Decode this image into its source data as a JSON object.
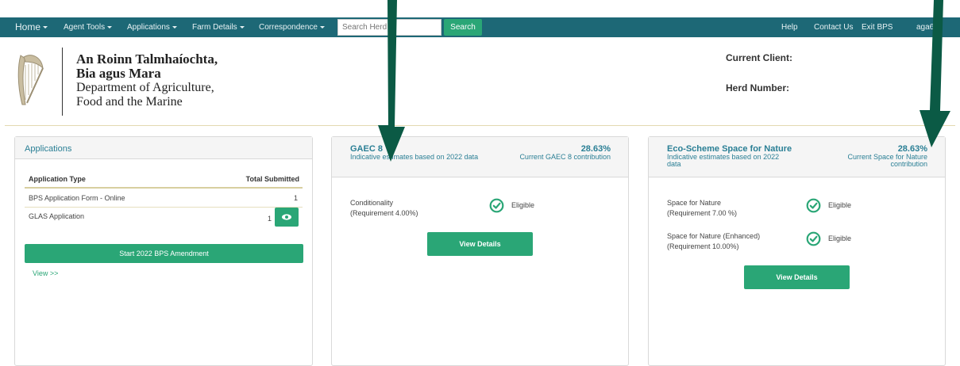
{
  "nav": {
    "home": "Home",
    "agent_tools": "Agent Tools",
    "applications": "Applications",
    "farm_details": "Farm Details",
    "correspondence": "Correspondence",
    "search_placeholder": "Search Herd",
    "search_button": "Search",
    "help": "Help",
    "contact_us": "Contact Us",
    "exit_bps": "Exit BPS",
    "user": "aga6r5"
  },
  "header": {
    "dept_line1": "An Roinn Talmhaíochta,",
    "dept_line2": "Bia agus Mara",
    "dept_line3": "Department of Agriculture,",
    "dept_line4": "Food and the Marine",
    "current_client_label": "Current Client:",
    "herd_number_label": "Herd Number:"
  },
  "applications_panel": {
    "title": "Applications",
    "col_type": "Application Type",
    "col_total": "Total Submitted",
    "rows": [
      {
        "type": "BPS Application Form - Online",
        "total": "1"
      },
      {
        "type": "GLAS Application",
        "total": "1"
      }
    ],
    "amend_button": "Start 2022 BPS Amendment",
    "view_link": "View >>"
  },
  "gaec_card": {
    "title": "GAEC 8",
    "subtitle": "Indicative estimates based on 2022 data",
    "percent": "28.63%",
    "percent_label": "Current GAEC 8 contribution",
    "criteria": [
      {
        "label": "Conditionality",
        "requirement": "(Requirement 4.00%)",
        "status": "Eligible"
      }
    ],
    "button": "View Details"
  },
  "eco_card": {
    "title": "Eco-Scheme Space for Nature",
    "subtitle": "Indicative estimates based on 2022 data",
    "percent": "28.63%",
    "percent_label": "Current Space for Nature contribution",
    "criteria": [
      {
        "label": "Space for Nature",
        "requirement": "(Requirement 7.00 %)",
        "status": "Eligible"
      },
      {
        "label": "Space for Nature (Enhanced)",
        "requirement": "(Requirement 10.00%)",
        "status": "Eligible"
      }
    ],
    "button": "View Details"
  },
  "colors": {
    "navbar": "#1d6876",
    "accent_green": "#2aa676",
    "title_teal": "#2a7f95",
    "annotation_arrow": "#0b5a45"
  }
}
